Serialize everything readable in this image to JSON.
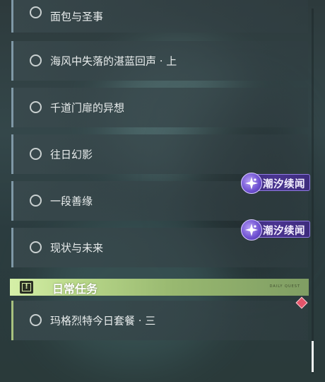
{
  "quests": [
    {
      "label": "面包与圣事"
    },
    {
      "label": "海风中失落的湛蓝回声 · 上"
    },
    {
      "label": "千道门扉的异想"
    },
    {
      "label": "往日幻影"
    },
    {
      "label": "一段善缘"
    },
    {
      "label": "现状与未来"
    }
  ],
  "tags": [
    {
      "label": "潮汐续闻",
      "icon": "tidal-sparkle-icon"
    },
    {
      "label": "潮汐续闻",
      "icon": "tidal-sparkle-icon"
    }
  ],
  "section": {
    "title": "日常任务",
    "icon": "exclamation-quest-icon",
    "deco_text": "DAILY QUEST"
  },
  "daily_quests": [
    {
      "label": "玛格烈特今日套餐 · 三"
    }
  ],
  "colors": {
    "quest_border": "#7f98a6",
    "daily_border": "#a8c17f",
    "tag_purple": "#4a3590",
    "section_green": "#b9d88a",
    "marker_red": "#e4546a"
  },
  "scrollbar": {
    "position_fraction": 0.97
  }
}
